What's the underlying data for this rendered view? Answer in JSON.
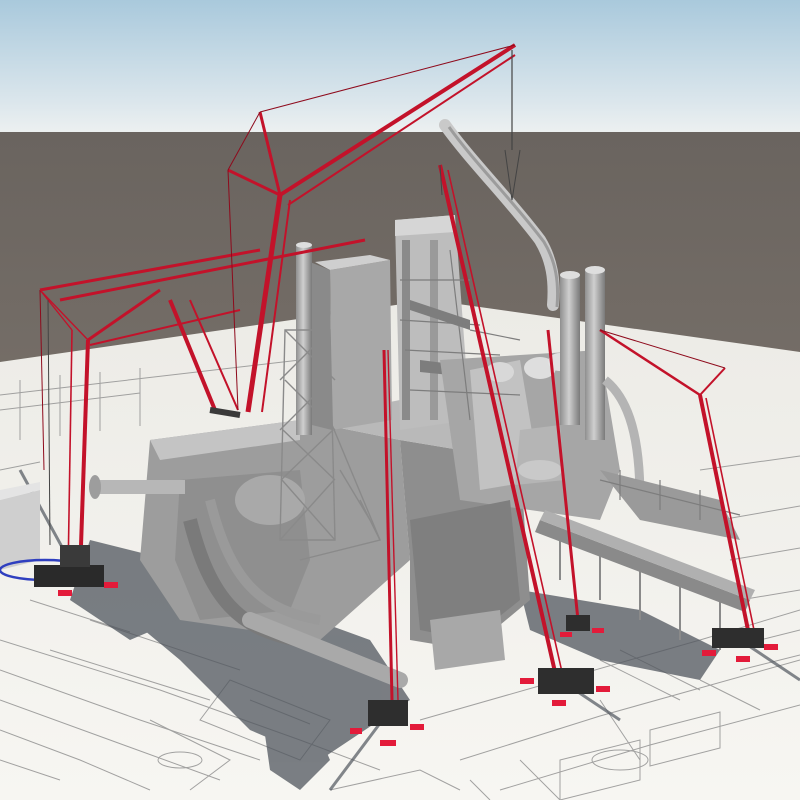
{
  "scene": {
    "description_colors": {
      "sky_top": "#a9c9dc",
      "sky_horizon": "#e4ecef",
      "ground_far": "#6f6863",
      "ground_near": "#847c74",
      "paper": "#f4f3ee",
      "drawing_line": "#8d8d8d",
      "structure_light": "#c8c8c8",
      "structure_mid": "#a6a6a6",
      "structure_dark": "#7d7d7d",
      "shadow": "#555a60",
      "crane_red": "#c3122a",
      "crane_dark": "#8e0a1c",
      "pad_red": "#e31b3a",
      "ring_blue": "#2f3fbf"
    },
    "objects": [
      "ground-plan-sheet",
      "blast-furnace-structure",
      "crawler-crane-left-front",
      "crawler-crane-left-back",
      "lattice-boom-crane-center",
      "crawler-crane-right",
      "crawler-crane-front-center",
      "pipe-rack"
    ]
  }
}
